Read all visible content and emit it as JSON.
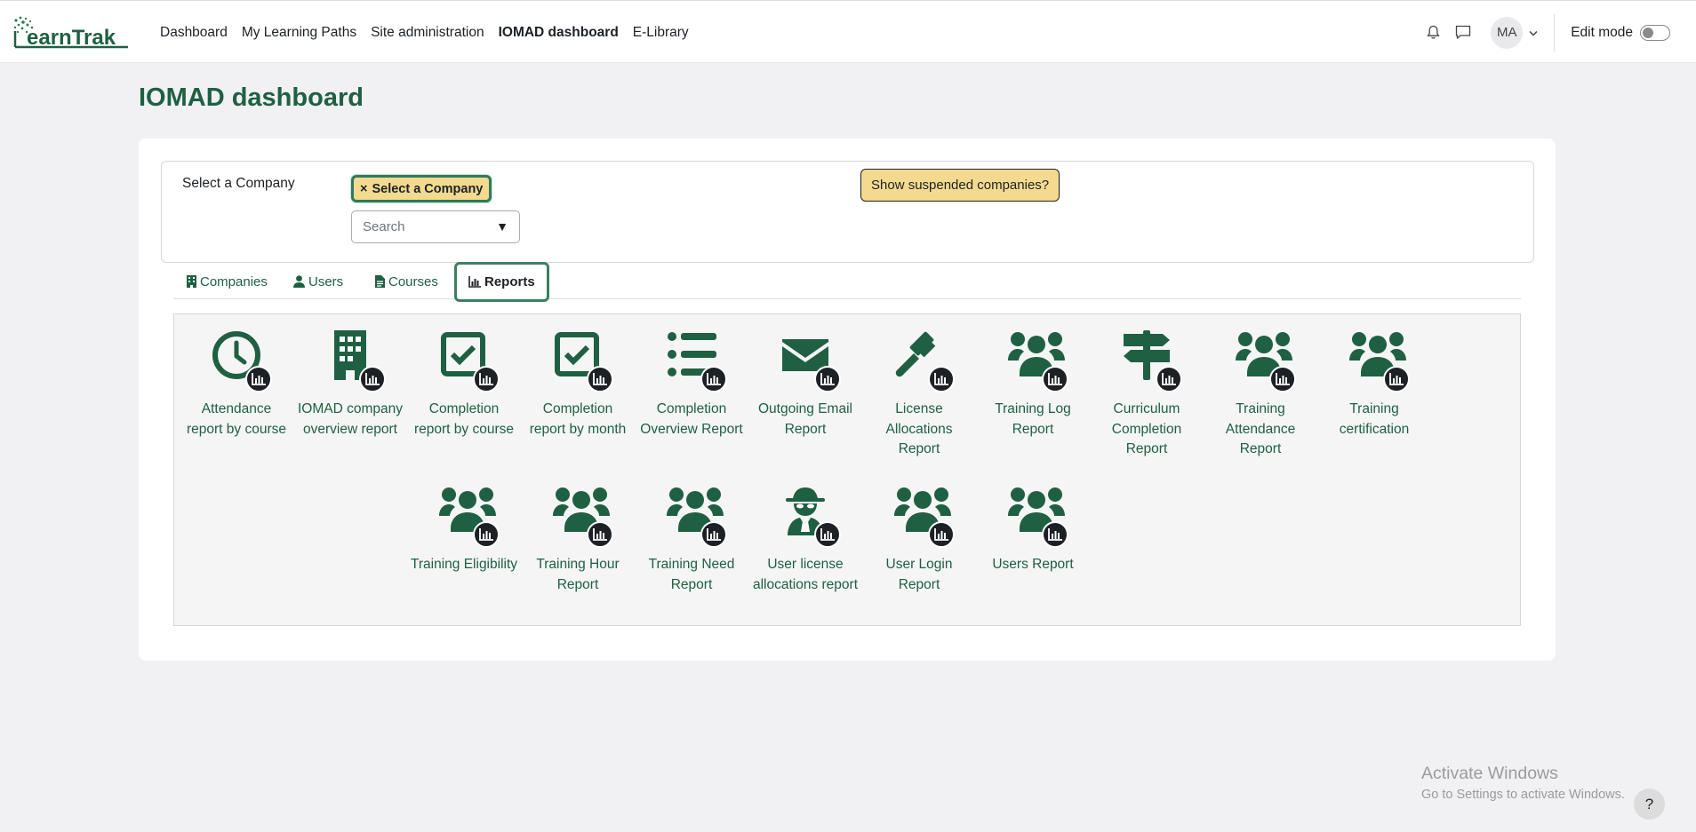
{
  "brand": {
    "logo_text": "LearnTrak",
    "accent": "#1f6043",
    "highlight": "#f3da8f"
  },
  "nav": {
    "links": [
      {
        "label": "Dashboard",
        "active": false
      },
      {
        "label": "My Learning Paths",
        "active": false
      },
      {
        "label": "Site administration",
        "active": false
      },
      {
        "label": "IOMAD dashboard",
        "active": true
      },
      {
        "label": "E-Library",
        "active": false
      }
    ],
    "avatar_initials": "MA",
    "edit_mode_label": "Edit mode",
    "edit_mode_on": false
  },
  "page": {
    "title": "IOMAD dashboard"
  },
  "company_selector": {
    "label": "Select a Company",
    "chip_label": "Select a Company",
    "chip_remove": "×",
    "search_placeholder": "Search",
    "show_suspended_label": "Show suspended companies?"
  },
  "tabs": [
    {
      "label": "Companies",
      "icon": "building-icon",
      "active": false
    },
    {
      "label": "Users",
      "icon": "user-icon",
      "active": false
    },
    {
      "label": "Courses",
      "icon": "file-icon",
      "active": false
    },
    {
      "label": "Reports",
      "icon": "chart-icon",
      "active": true
    }
  ],
  "reports": [
    {
      "label": "Attendance report by course",
      "icon": "clock-icon"
    },
    {
      "label": "IOMAD company overview report",
      "icon": "building-icon"
    },
    {
      "label": "Completion report by course",
      "icon": "checkbox-icon"
    },
    {
      "label": "Completion report by month",
      "icon": "checkbox-icon"
    },
    {
      "label": "Completion Overview Report",
      "icon": "list-icon"
    },
    {
      "label": "Outgoing Email Report",
      "icon": "envelope-icon"
    },
    {
      "label": "License Allocations Report",
      "icon": "gavel-icon"
    },
    {
      "label": "Training Log Report",
      "icon": "users-icon"
    },
    {
      "label": "Curriculum Completion Report",
      "icon": "signpost-icon"
    },
    {
      "label": "Training Attendance Report",
      "icon": "users-icon"
    },
    {
      "label": "Training certification",
      "icon": "users-icon"
    },
    {
      "label": "Training Eligibility",
      "icon": "users-icon"
    },
    {
      "label": "Training Hour Report",
      "icon": "users-icon"
    },
    {
      "label": "Training Need Report",
      "icon": "users-icon"
    },
    {
      "label": "User license allocations report",
      "icon": "user-secret-icon"
    },
    {
      "label": "User Login Report",
      "icon": "users-icon"
    },
    {
      "label": "Users Report",
      "icon": "users-icon"
    }
  ],
  "watermark": {
    "line1": "Activate Windows",
    "line2": "Go to Settings to activate Windows."
  },
  "help": {
    "label": "?"
  }
}
